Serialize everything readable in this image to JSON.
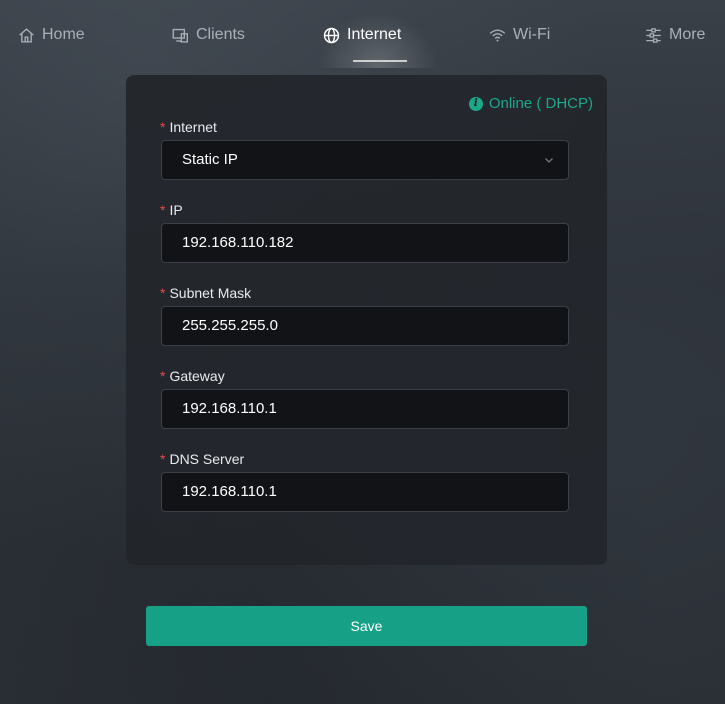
{
  "nav": {
    "items": [
      {
        "label": "Home",
        "icon": "home-icon"
      },
      {
        "label": "Clients",
        "icon": "clients-icon"
      },
      {
        "label": "Internet",
        "icon": "globe-icon",
        "active": true
      },
      {
        "label": "Wi-Fi",
        "icon": "wifi-icon"
      },
      {
        "label": "More",
        "icon": "more-icon"
      }
    ]
  },
  "status": {
    "text": "Online ( DHCP)",
    "icon": "info-icon",
    "color": "#1aa78a"
  },
  "form": {
    "internet": {
      "label": "Internet",
      "value": "Static IP",
      "required_mark": "*"
    },
    "ip": {
      "label": "IP",
      "value": "192.168.110.182",
      "required_mark": "*"
    },
    "subnet": {
      "label": "Subnet Mask",
      "value": "255.255.255.0",
      "required_mark": "*"
    },
    "gateway": {
      "label": "Gateway",
      "value": "192.168.110.1",
      "required_mark": "*"
    },
    "dns": {
      "label": "DNS Server",
      "value": "192.168.110.1",
      "required_mark": "*"
    }
  },
  "save_label": "Save",
  "colors": {
    "accent": "#16a085",
    "required": "#e44b4b"
  }
}
